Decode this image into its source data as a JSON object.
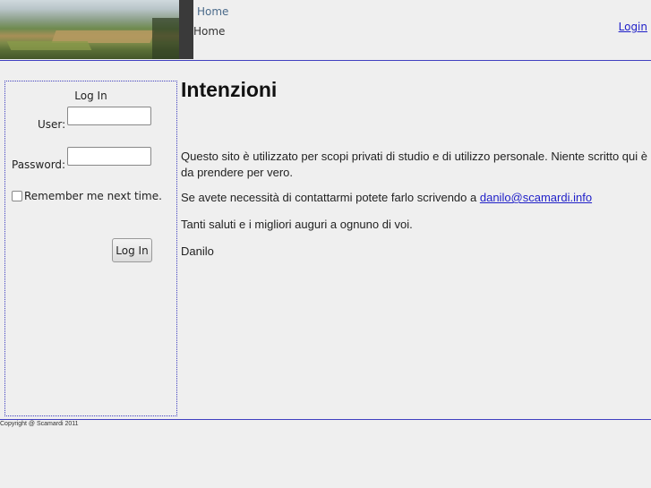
{
  "header": {
    "nav_link": "Home",
    "breadcrumb": "Home",
    "login_link": "Login"
  },
  "login_box": {
    "title": "Log In",
    "user_label": "User:",
    "user_value": "",
    "password_label": "Password:",
    "password_value": "",
    "remember_label": "Remember me next time.",
    "remember_checked": false,
    "submit_label": "Log In"
  },
  "main": {
    "heading": "Intenzioni",
    "paragraph1": "Questo sito è utilizzato per scopi privati di studio e di utilizzo personale. Niente scritto qui è da prendere per vero.",
    "paragraph2_prefix": "Se avete necessità di contattarmi potete farlo scrivendo a ",
    "email": "danilo@scamardi.info",
    "paragraph3": "Tanti saluti e i migliori auguri a ognuno di voi.",
    "signature": "Danilo"
  },
  "footer": {
    "copyright": "Copyright @ Scamardi 2011"
  },
  "colors": {
    "rule": "#4040c0",
    "link": "#1f1fc8",
    "background": "#efefef"
  }
}
